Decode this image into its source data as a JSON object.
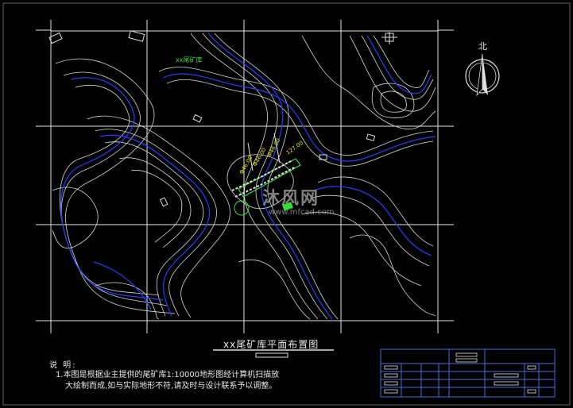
{
  "drawing": {
    "title": "xx尾矿库平面布置图",
    "north_label": "北",
    "tailings_label": "xx尾矿库",
    "notes_heading": "说 明:",
    "notes": [
      "1.本图是根据业主提供的尾矿库1:10000地形图经计算机扫描放",
      "大绘制而成,如与实际地形不符,请及时与设计联系予以调整。"
    ],
    "dam_labels": [
      "Φ46.00",
      "Φ46.00",
      "Φ46.00",
      "127.00"
    ]
  },
  "watermark": {
    "text": "沐风网",
    "url": "www.mfcad.com"
  },
  "colors": {
    "background": "#000000",
    "contour": "#d8d8d8",
    "index_contour": "#2a3cff",
    "grid": "#e0e0e0",
    "dam_green": "#33dd33",
    "title_block": "#3f6fe0"
  }
}
